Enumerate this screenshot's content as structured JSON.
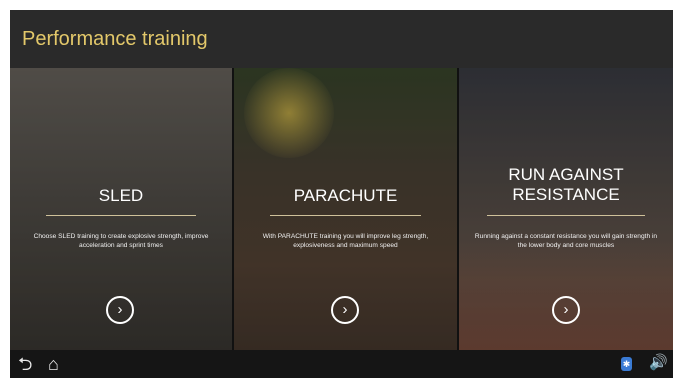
{
  "header": {
    "title": "Performance training"
  },
  "panels": [
    {
      "title": "SLED",
      "description": "Choose SLED training to create explosive strength, improve acceleration and sprint times"
    },
    {
      "title": "PARACHUTE",
      "description": "With PARACHUTE training you will improve leg strength, explosiveness and maximum speed"
    },
    {
      "title": "RUN AGAINST RESISTANCE",
      "description": "Running against a constant resistance you will gain strength in the lower body and core muscles"
    }
  ],
  "icons": {
    "open": "chevron-right-circle-icon",
    "back": "back-arrow-icon",
    "home": "home-icon",
    "bluetooth": "bluetooth-icon",
    "volume": "speaker-icon"
  },
  "colors": {
    "title_accent": "#e3c86a",
    "bluetooth": "#3a7bd5"
  }
}
